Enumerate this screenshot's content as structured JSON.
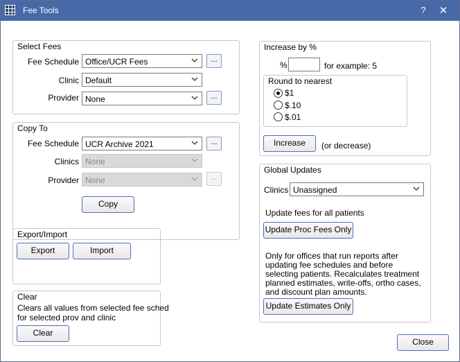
{
  "window": {
    "title": "Fee Tools",
    "help": "?",
    "close_glyph": "✕"
  },
  "select_fees": {
    "title": "Select Fees",
    "fee_schedule_label": "Fee Schedule",
    "fee_schedule_value": "Office/UCR Fees",
    "clinic_label": "Clinic",
    "clinic_value": "Default",
    "provider_label": "Provider",
    "provider_value": "None",
    "ellipsis": "..."
  },
  "copy_to": {
    "title": "Copy To",
    "fee_schedule_label": "Fee Schedule",
    "fee_schedule_value": "UCR Archive 2021",
    "clinics_label": "Clinics",
    "clinics_value": "None",
    "provider_label": "Provider",
    "provider_value": "None",
    "copy_button": "Copy",
    "ellipsis": "..."
  },
  "export_import": {
    "title": "Export/Import",
    "export_button": "Export",
    "import_button": "Import"
  },
  "clear": {
    "title": "Clear",
    "desc_line1": "Clears all values from selected fee sched",
    "desc_line2": "for selected prov and clinic",
    "clear_button": "Clear"
  },
  "increase": {
    "title": "Increase by %",
    "percent_symbol": "%",
    "percent_value": "",
    "example": "for example: 5",
    "round_title": "Round to nearest",
    "round_options": [
      "$1",
      "$.10",
      "$.01"
    ],
    "round_selected": "$1",
    "increase_button": "Increase",
    "decrease_note": "(or decrease)"
  },
  "global_updates": {
    "title": "Global Updates",
    "clinics_label": "Clinics",
    "clinics_value": "Unassigned",
    "update_fees_text": "Update fees for all patients",
    "update_proc_button": "Update Proc Fees Only",
    "offices_text": [
      "Only for offices that run reports after",
      "updating fee schedules and before",
      "selecting patients. Recalculates treatment",
      "planned estimates, write-offs, ortho cases,",
      "and discount plan amounts."
    ],
    "update_estimates_button": "Update Estimates Only"
  },
  "footer": {
    "close_button": "Close"
  },
  "colors": {
    "titlebar": "#4769a8",
    "button_border": "#4b6fb0"
  }
}
